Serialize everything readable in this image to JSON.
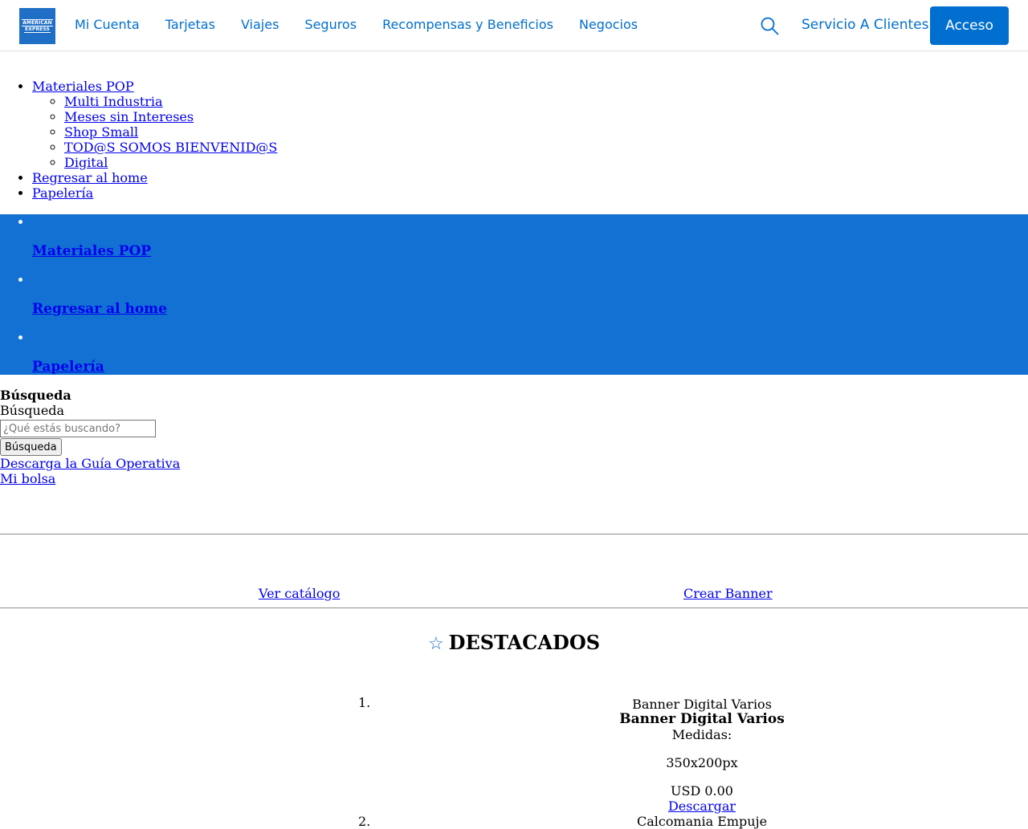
{
  "header": {
    "logo_text": [
      "AMERICAN",
      "EXPRESS"
    ],
    "nav": [
      "Mi Cuenta",
      "Tarjetas",
      "Viajes",
      "Seguros",
      "Recompensas y Beneficios",
      "Negocios"
    ],
    "service_label": "Servicio A Clientes",
    "login_label": "Acceso",
    "accent_color": "#006fcf"
  },
  "menu": {
    "items": [
      {
        "label": "Materiales POP",
        "children": [
          "Multi Industria",
          "Meses sin Intereses",
          "Shop Small",
          "TOD@S SOMOS BIENVENID@S",
          "Digital"
        ]
      },
      {
        "label": "Regresar al home"
      },
      {
        "label": "Papelería"
      }
    ]
  },
  "band": {
    "color": "#1271d3",
    "items": [
      "Materiales POP",
      "Regresar al home",
      "Papelería"
    ]
  },
  "search": {
    "heading": "Búsqueda",
    "label": "Búsqueda",
    "placeholder": "¿Qué estás buscando?",
    "button": "Búsqueda"
  },
  "links": {
    "guide": "Descarga la Guía Operativa",
    "bag": "Mi bolsa",
    "catalog": "Ver catálogo",
    "create_banner": "Crear Banner"
  },
  "featured": {
    "title": "DESTACADOS",
    "products": [
      {
        "number": "1.",
        "image_alt": "Banner Digital Varios",
        "name": "Banner Digital Varios",
        "measures_label": "Medidas:",
        "measures": "350x200px",
        "price": "USD 0.00",
        "action": "Descargar"
      },
      {
        "number": "2.",
        "image_alt": "Calcomania Empuje"
      }
    ]
  }
}
